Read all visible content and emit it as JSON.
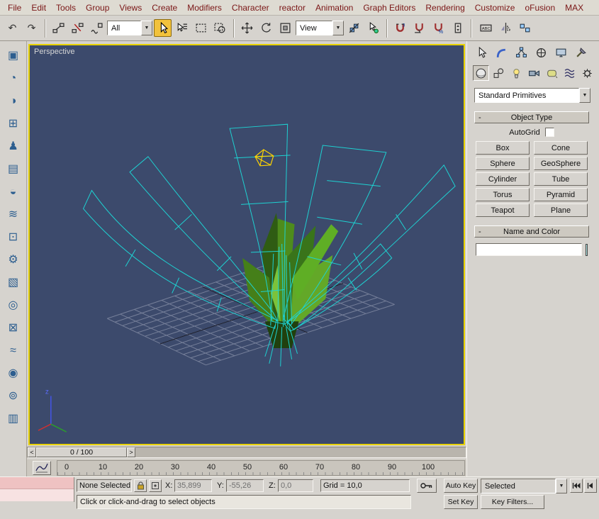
{
  "menu": {
    "items": [
      "File",
      "Edit",
      "Tools",
      "Group",
      "Views",
      "Create",
      "Modifiers",
      "Character",
      "reactor",
      "Animation",
      "Graph Editors",
      "Rendering",
      "Customize",
      "oFusion",
      "MAX"
    ]
  },
  "main_toolbar": {
    "selection_filter": "All",
    "coordinate_system": "View",
    "icons": {
      "undo": "↶",
      "redo": "↷",
      "dropdown_arrow": "▼"
    },
    "snap_three": "3",
    "snap_percent": "%",
    "named_sel": "ABC"
  },
  "left_toolbar": {
    "glyphs": [
      "▣",
      "◔",
      "◑",
      "⊞",
      "♟",
      "▤",
      "◒",
      "≋",
      "⊡",
      "⚙",
      "▧",
      "◎",
      "⊠",
      "≈",
      "◉",
      "⊚",
      "▥"
    ]
  },
  "viewport": {
    "label": "Perspective",
    "axis_z": "z"
  },
  "command_panel": {
    "primitives_dropdown": "Standard Primitives",
    "object_type": {
      "title": "Object Type",
      "collapse": "-",
      "autogrid": "AutoGrid",
      "buttons": [
        "Box",
        "Cone",
        "Sphere",
        "GeoSphere",
        "Cylinder",
        "Tube",
        "Torus",
        "Pyramid",
        "Teapot",
        "Plane"
      ]
    },
    "name_color": {
      "title": "Name and Color",
      "collapse": "-",
      "name_value": ""
    }
  },
  "timeline": {
    "slider": "0 / 100",
    "prev": "<",
    "next": ">",
    "ticks": [
      "0",
      "10",
      "20",
      "30",
      "40",
      "50",
      "60",
      "70",
      "80",
      "90",
      "100"
    ]
  },
  "status_bar": {
    "selection": "None Selected",
    "x_label": "X:",
    "x": "35,899",
    "y_label": "Y:",
    "y": "-55,26",
    "z_label": "Z:",
    "z": "0,0",
    "grid": "Grid = 10,0",
    "auto_key": "Auto Key",
    "set_key": "Set Key",
    "key_filters": "Key Filters...",
    "time_config_selected": "Selected",
    "prompt": "Click or click-and-drag to select objects"
  },
  "colors": {
    "viewport_background": "#3c4a6c",
    "wireframe": "#1ed2d2",
    "active_viewport_border": "#e8d200",
    "selection_gizmo": "#ffd400",
    "object_color_swatch": "#b2e8e6"
  }
}
